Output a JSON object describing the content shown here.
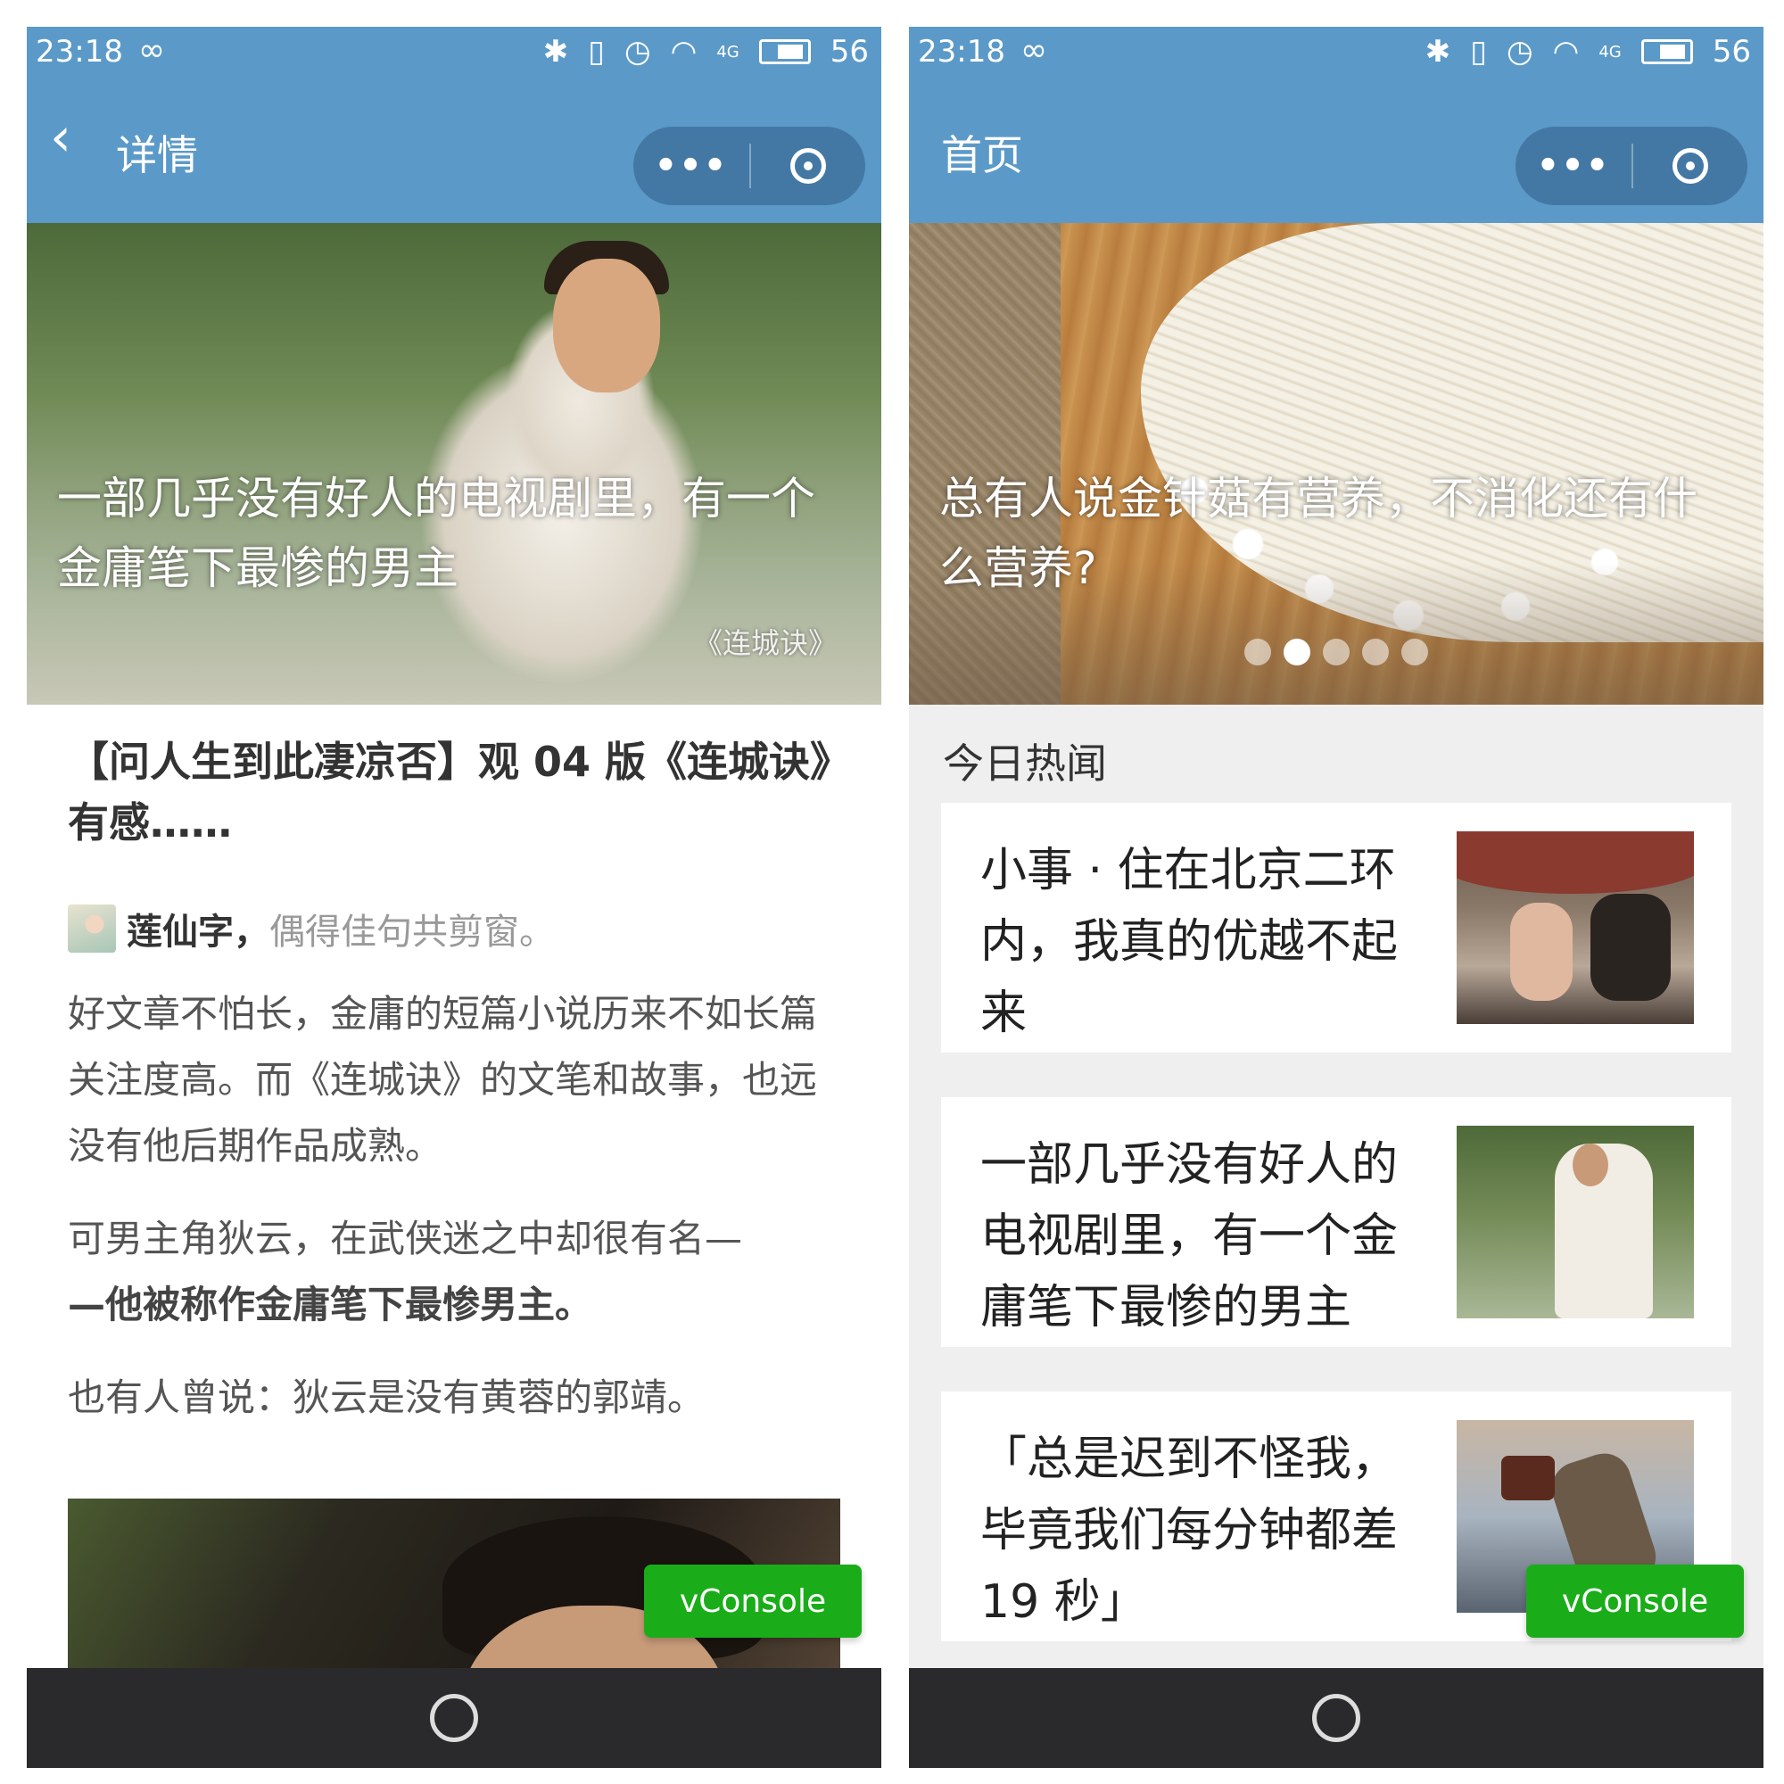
{
  "status_bar": {
    "time": "23:18",
    "link_icon": "∞",
    "network_label": "4G",
    "battery": "56"
  },
  "left": {
    "nav": {
      "back_icon": "chevron-left-icon",
      "title": "详情"
    },
    "hero": {
      "title": "一部几乎没有好人的电视剧里，有一个金庸笔下最惨的男主",
      "caption": "《连城诀》"
    },
    "article": {
      "heading": "【问人生到此凄凉否】观 04 版《连城诀》有感……",
      "author_name": "莲仙字，",
      "author_signature": "偶得佳句共剪窗。",
      "paragraphs": [
        "好文章不怕长，金庸的短篇小说历来不如长篇关注度高。而《连城诀》的文笔和故事，也远没有他后期作品成熟。",
        "可男主角狄云，在武侠迷之中却很有名—",
        "—他被称作金庸笔下最惨男主。",
        "也有人曾说：狄云是没有黄蓉的郭靖。"
      ]
    },
    "vconsole_label": "vConsole"
  },
  "right": {
    "nav": {
      "title": "首页"
    },
    "hero": {
      "title": "总有人说金针菇有营养，不消化还有什么营养?",
      "dots_count": 5,
      "active_dot": 2
    },
    "section_label": "今日热闻",
    "cards": [
      {
        "title": "小事 · 住在北京二环内，我真的优越不起来"
      },
      {
        "title": "一部几乎没有好人的电视剧里，有一个金庸笔下最惨的男主"
      },
      {
        "title": "「总是迟到不怪我，毕竟我们每分钟都差 19 秒」"
      }
    ],
    "vconsole_label": "vConsole"
  },
  "colors": {
    "nav_blue": "#5b9ac8",
    "vconsole_green": "#1aad19",
    "bottom_bar": "#2a2a2c"
  }
}
